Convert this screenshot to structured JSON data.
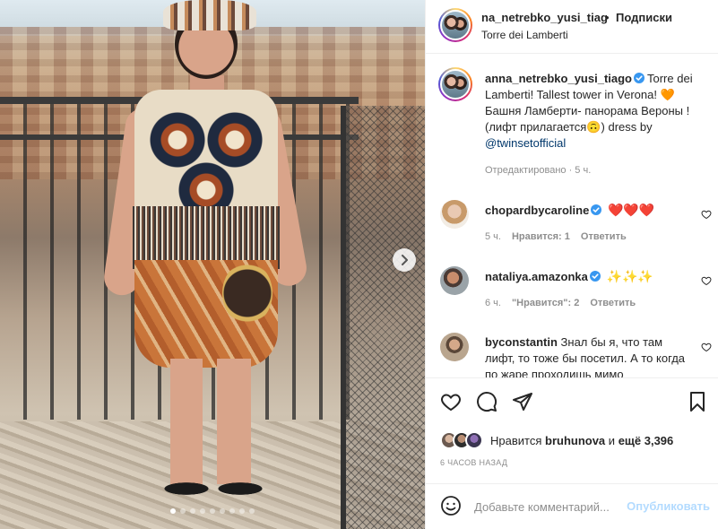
{
  "post": {
    "username": "anna_netrebko_yusi_tiago",
    "header_username": "na_netrebko_yusi_tiago",
    "separator": "•",
    "follow_label": "Подписки",
    "location": "Torre dei Lamberti",
    "more_icon": "more-horizontal-icon"
  },
  "caption": {
    "username": "anna_netrebko_yusi_tiago",
    "text_before_emoji": "Torre dei Lamberti! Tallest tower in Verona!",
    "emoji_1": "🧡",
    "text_middle": "Башня Ламберти- панорама Вероны ! (лифт прилагается",
    "emoji_2": "🙃",
    "text_after": ") dress by",
    "mention": "@twinsetofficial",
    "meta": "Отредактировано · 5 ч."
  },
  "comments": [
    {
      "username": "chopardbycaroline",
      "text": "❤️❤️❤️",
      "time": "5 ч.",
      "likes": "Нравится: 1",
      "reply": "Ответить"
    },
    {
      "username": "nataliya.amazonka",
      "text": "✨✨✨",
      "time": "6 ч.",
      "likes": "\"Нравится\": 2",
      "reply": "Ответить"
    },
    {
      "username": "byconstantin",
      "text": "Знал бы я, что там лифт, то тоже бы посетил. А то когда по жаре проходишь мимо"
    }
  ],
  "likes": {
    "prefix": "Нравится",
    "user": "bruhunova",
    "middle": "и",
    "count": "ещё 3,396"
  },
  "time_ago": "6 ЧАСОВ НАЗАД",
  "composer": {
    "placeholder": "Добавьте комментарий...",
    "publish_label": "Опубликовать"
  },
  "carousel": {
    "total_slides": 9,
    "active_index": 0
  },
  "colors": {
    "verified": "#3897f0",
    "link": "#00376b",
    "muted": "#8e8e8e",
    "publish_disabled": "#b3dbff"
  }
}
